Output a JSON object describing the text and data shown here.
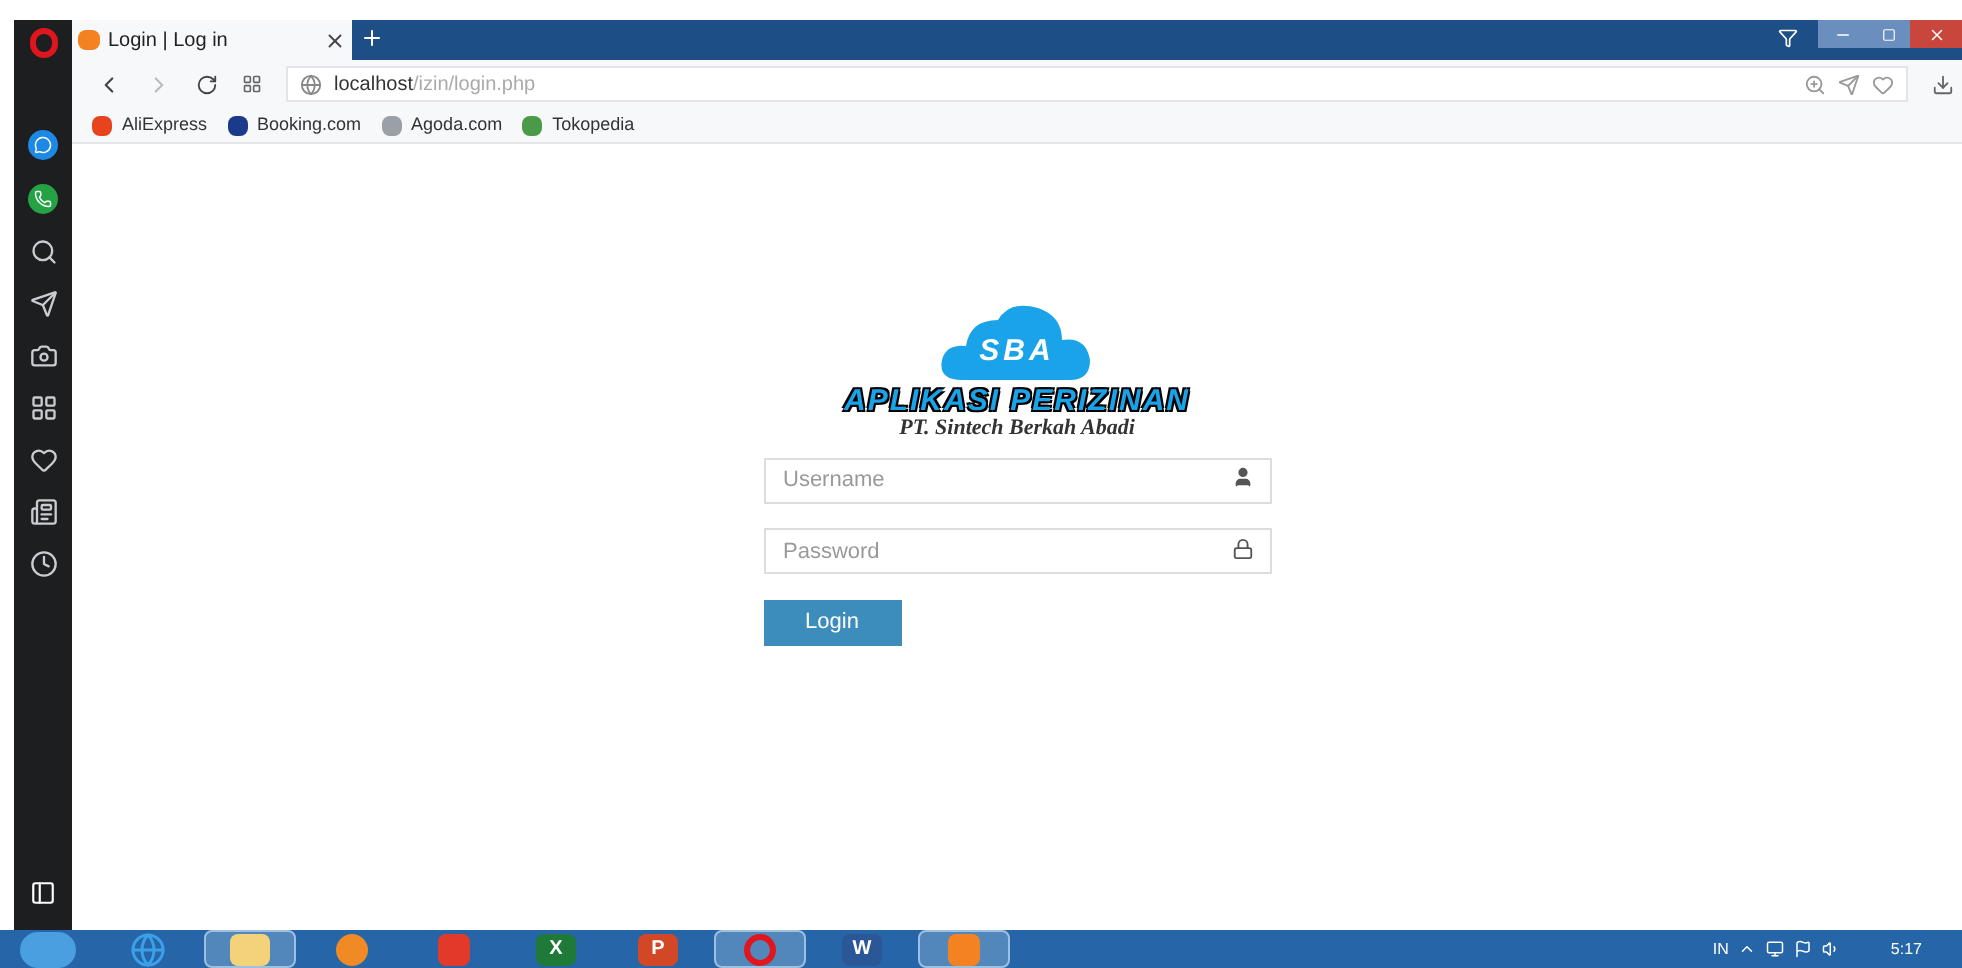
{
  "tab": {
    "title": "Login | Log in"
  },
  "address": {
    "url": "**localhost**/izin/login.php"
  },
  "bookmarks": [
    {
      "label": "AliExpress",
      "color": "#e8431f"
    },
    {
      "label": "Booking.com",
      "color": "#1a3a8a"
    },
    {
      "label": "Agoda.com",
      "color": "#9aa0a6"
    },
    {
      "label": "Tokopedia",
      "color": "#4a9a4a"
    }
  ],
  "sidebar": {
    "items": [
      {
        "kind": "messenger"
      },
      {
        "kind": "whatsapp"
      },
      {
        "kind": "search"
      },
      {
        "kind": "send"
      },
      {
        "kind": "camera"
      },
      {
        "kind": "apps"
      },
      {
        "kind": "heart"
      },
      {
        "kind": "news"
      },
      {
        "kind": "history"
      }
    ]
  },
  "login": {
    "logo_letters": "SBA",
    "title": "APLIKASI PERIZINAN",
    "subtitle": "PT. Sintech Berkah Abadi",
    "username": {
      "placeholder": "Username"
    },
    "password": {
      "placeholder": "Password"
    },
    "button": "Login"
  },
  "taskbar": {
    "apps": [
      {
        "kind": "ie",
        "running": false
      },
      {
        "kind": "folder",
        "running": true
      },
      {
        "kind": "media",
        "running": false
      },
      {
        "kind": "app",
        "running": false
      },
      {
        "kind": "doc",
        "letter": "X",
        "color": "#1f7a3a",
        "running": false
      },
      {
        "kind": "doc",
        "letter": "P",
        "color": "#d24726",
        "running": false
      },
      {
        "kind": "opera",
        "running": true
      },
      {
        "kind": "doc",
        "letter": "W",
        "color": "#2b5797",
        "running": false
      },
      {
        "kind": "xampp",
        "running": true
      }
    ],
    "language": "IN",
    "time": "5:17"
  }
}
